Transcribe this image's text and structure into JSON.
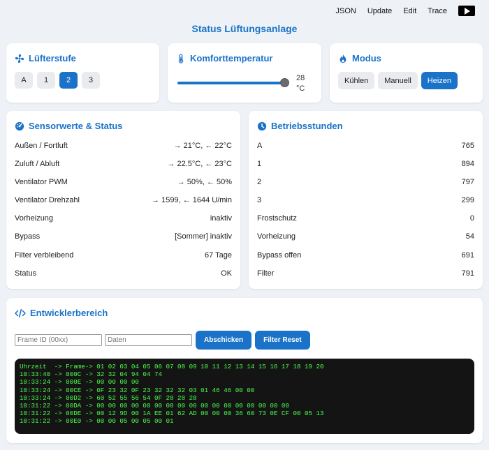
{
  "topnav": {
    "json": "JSON",
    "update": "Update",
    "edit": "Edit",
    "trace": "Trace"
  },
  "page_title": "Status Lüftungsanlage",
  "fan": {
    "title": "Lüfterstufe",
    "levels": [
      "A",
      "1",
      "2",
      "3"
    ],
    "active": "2"
  },
  "temperature": {
    "title": "Komforttemperatur",
    "value": "28",
    "unit": "°C",
    "level_percent": 100
  },
  "mode": {
    "title": "Modus",
    "options": [
      "Kühlen",
      "Manuell",
      "Heizen"
    ],
    "active": "Heizen"
  },
  "sensor": {
    "title": "Sensorwerte & Status",
    "rows": [
      {
        "label": "Außen / Fortluft",
        "value": "→ 21°C, ← 22°C"
      },
      {
        "label": "Zuluft / Abluft",
        "value": "→ 22.5°C, ← 23°C"
      },
      {
        "label": "Ventilator PWM",
        "value": "→ 50%, ← 50%"
      },
      {
        "label": "Ventilator Drehzahl",
        "value": "→ 1599, ← 1644 U/min"
      },
      {
        "label": "Vorheizung",
        "value": "inaktiv"
      },
      {
        "label": "Bypass",
        "value": "[Sommer] inaktiv"
      },
      {
        "label": "Filter verbleibend",
        "value": "67 Tage"
      },
      {
        "label": "Status",
        "value": "OK"
      }
    ]
  },
  "hours": {
    "title": "Betriebsstunden",
    "rows": [
      {
        "label": "A",
        "value": "765"
      },
      {
        "label": "1",
        "value": "894"
      },
      {
        "label": "2",
        "value": "797"
      },
      {
        "label": "3",
        "value": "299"
      },
      {
        "label": "Frostschutz",
        "value": "0"
      },
      {
        "label": "Vorheizung",
        "value": "54"
      },
      {
        "label": "Bypass offen",
        "value": "691"
      },
      {
        "label": "Filter",
        "value": "791"
      }
    ]
  },
  "dev": {
    "title": "Entwicklerbereich",
    "frame_id_placeholder": "Frame ID (00xx)",
    "data_placeholder": "Daten",
    "send_label": "Abschicken",
    "filter_reset_label": "Filter Reset",
    "console_lines": [
      "Uhrzeit  -> Frame-> 01 02 03 04 05 06 07 08 09 10 11 12 13 14 15 16 17 18 19 20",
      "10:33:40 -> 000C -> 32 32 04 94 04 74",
      "10:33:24 -> 000E -> 00 00 00 00",
      "10:33:24 -> 00CE -> 0F 23 32 0F 23 32 32 32 03 01 46 46 00 00",
      "10:33:24 -> 00D2 -> 60 52 55 56 54 0F 28 28 28",
      "10:31:22 -> 00DA -> 00 00 00 00 00 00 00 00 00 00 00 00 00 00 00 00 00",
      "10:31:22 -> 00DE -> 00 12 9D 00 1A EE 01 62 AD 00 00 00 36 60 73 0E CF 00 05 13",
      "10:31:22 -> 00E0 -> 00 00 05 00 05 00 01"
    ]
  }
}
